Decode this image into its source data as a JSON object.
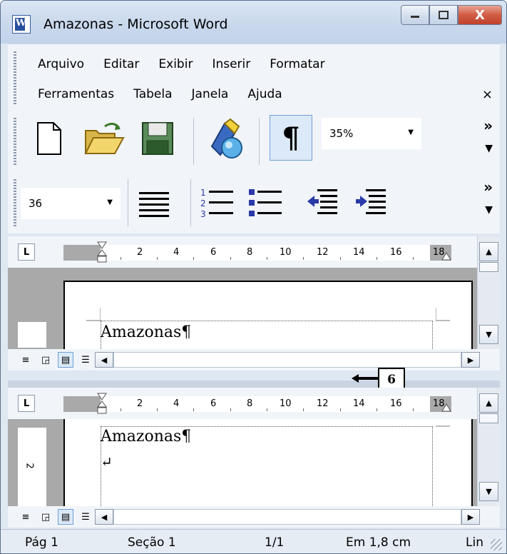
{
  "window": {
    "title": "Amazonas - Microsoft Word",
    "controls": {
      "minimize": "—",
      "maximize": "▢",
      "close": "X"
    }
  },
  "menu": {
    "row1": [
      "Arquivo",
      "Editar",
      "Exibir",
      "Inserir",
      "Formatar"
    ],
    "row2": [
      "Ferramentas",
      "Tabela",
      "Janela",
      "Ajuda"
    ],
    "close_glyph": "×"
  },
  "toolbar1": {
    "zoom_value": "35%",
    "pilcrow": "¶",
    "chevron": "»",
    "dropdown": "▼"
  },
  "toolbar2": {
    "font_size_value": "36",
    "chevron": "»",
    "dropdown": "▼"
  },
  "ruler": {
    "numbers": [
      "2",
      "4",
      "6",
      "8",
      "10",
      "12",
      "14",
      "16",
      "18"
    ],
    "tab_selector": "L"
  },
  "pane1": {
    "text": "Amazonas¶"
  },
  "pane2": {
    "text": "Amazonas¶",
    "line_break": "↵",
    "vruler_number": "2"
  },
  "callout": {
    "label": "6"
  },
  "status": {
    "page": "Pág 1",
    "section": "Seção 1",
    "pages": "1/1",
    "position": "Em 1,8 cm",
    "line": "Lin"
  }
}
